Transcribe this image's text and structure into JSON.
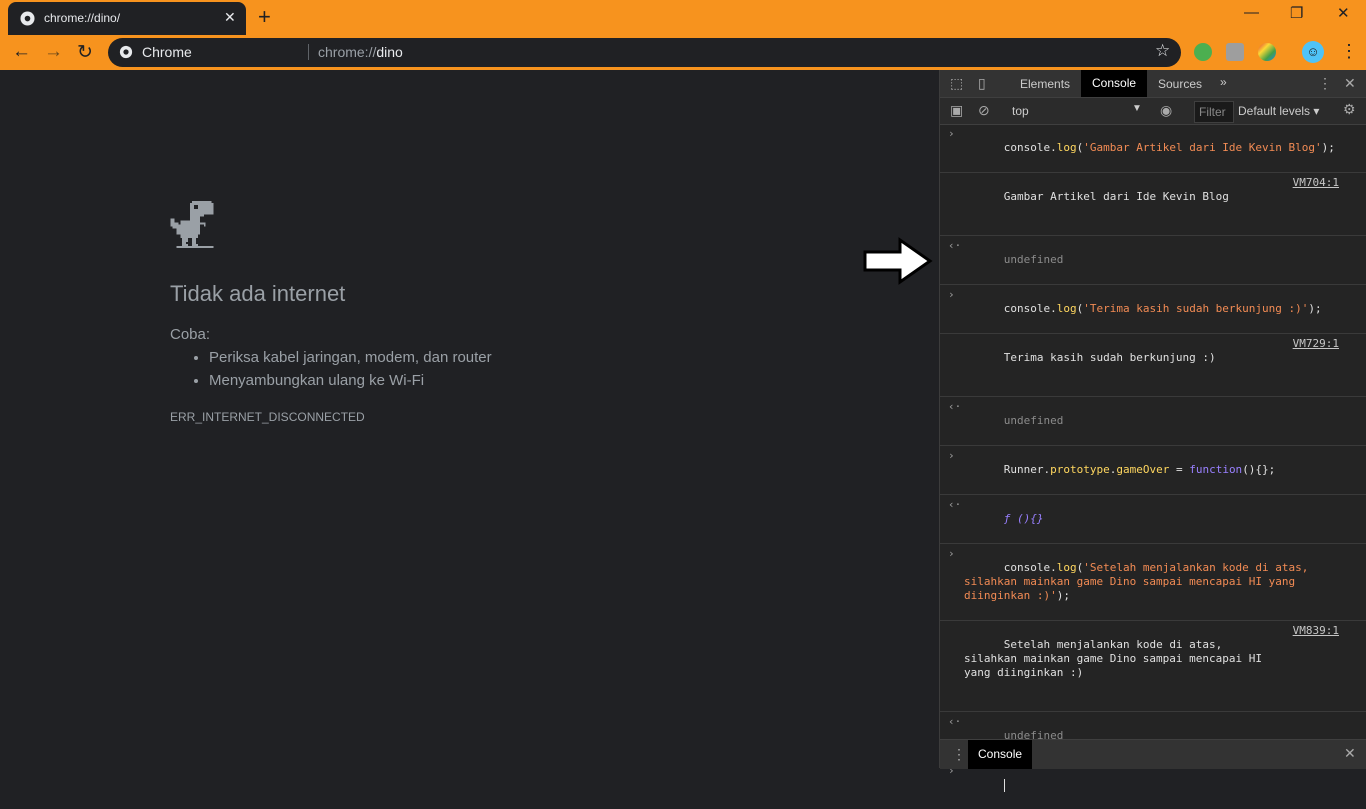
{
  "browser": {
    "tab_title": "chrome://dino/",
    "tab_close": "✕",
    "new_tab": "+",
    "win_min": "—",
    "win_restore": "❐",
    "win_close": "✕",
    "back": "←",
    "forward": "→",
    "reload": "↻",
    "chip_label": "Chrome",
    "url_scheme": "chrome://",
    "url_host": "dino",
    "bookmark": "☆",
    "avatar_glyph": "☺",
    "menu": "⋮",
    "accent_color": "#f7931e"
  },
  "page": {
    "heading": "Tidak ada internet",
    "try_label": "Coba:",
    "suggestions": [
      "Periksa kabel jaringan, modem, dan router",
      "Menyambungkan ulang ke Wi-Fi"
    ],
    "error_code": "ERR_INTERNET_DISCONNECTED"
  },
  "devtools": {
    "tabs": {
      "elements": "Elements",
      "console": "Console",
      "sources": "Sources",
      "more": "»"
    },
    "context": "top",
    "filter_placeholder": "Filter",
    "levels": "Default levels ▾",
    "console": {
      "cmd1": {
        "pre": "console.",
        "method": "log",
        "open": "(",
        "str": "'Gambar Artikel dari Ide Kevin Blog'",
        "close": ");"
      },
      "out1": {
        "text": "Gambar Artikel dari Ide Kevin Blog",
        "source": "VM704:1"
      },
      "undef": "undefined",
      "cmd2": {
        "pre": "console.",
        "method": "log",
        "open": "(",
        "str": "'Terima kasih sudah berkunjung :)'",
        "close": ");"
      },
      "out2": {
        "text": "Terima kasih sudah berkunjung :)",
        "source": "VM729:1"
      },
      "cmd3": {
        "obj": "Runner.",
        "proto": "prototype",
        "dot": ".",
        "prop": "gameOver",
        "eq": " = ",
        "kw": "function",
        "rest": "(){};"
      },
      "ret3": {
        "f": "ƒ",
        "body": " (){}"
      },
      "cmd4": {
        "pre": "console.",
        "method": "log",
        "open": "(",
        "str": "'Setelah menjalankan kode di atas, silahkan mainkan game Dino sampai mencapai HI yang diinginkan :)'",
        "close": ");"
      },
      "out4": {
        "text": "Setelah menjalankan kode di atas, silahkan mainkan game Dino sampai mencapai HI yang diinginkan :)",
        "source": "VM839:1"
      }
    },
    "drawer": {
      "dots": "⋮",
      "tab": "Console",
      "close": "✕"
    }
  }
}
